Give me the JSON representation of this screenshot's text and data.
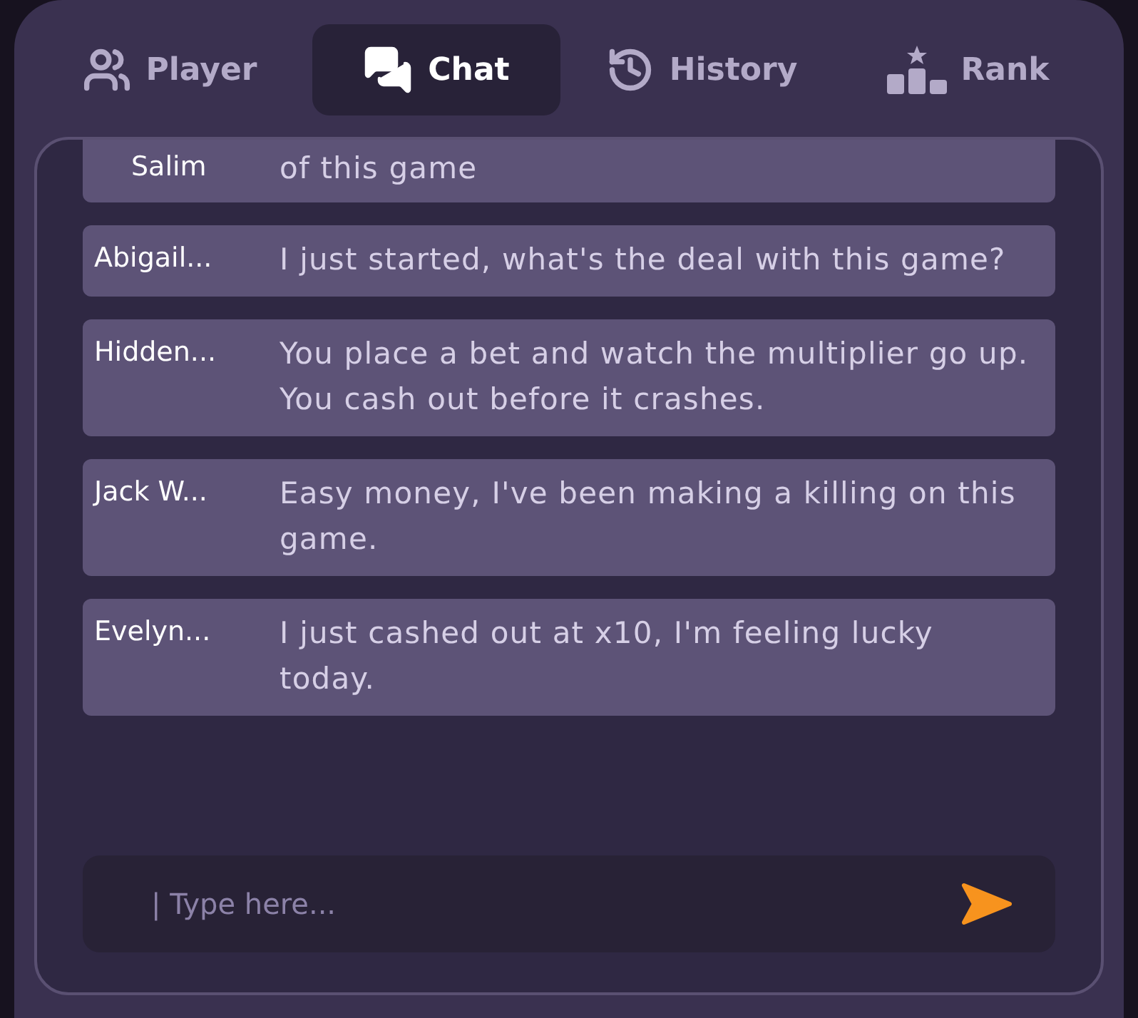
{
  "tabs": [
    {
      "label": "Player",
      "kind": "users",
      "selected": false
    },
    {
      "label": "Chat",
      "kind": "chat",
      "selected": true
    },
    {
      "label": "History",
      "kind": "history",
      "selected": false
    },
    {
      "label": "Rank",
      "kind": "rank",
      "selected": false
    }
  ],
  "messages": [
    {
      "name": "Salim",
      "text": "of this game"
    },
    {
      "name": "Abigail...",
      "text": "I just started, what's the deal with this game?"
    },
    {
      "name": "Hidden...",
      "text": "You place a bet and watch the multiplier go up. You cash out before it crashes."
    },
    {
      "name": "Jack W...",
      "text": "Easy money, I've been making a killing on this game."
    },
    {
      "name": "Evelyn...",
      "text": "I just cashed out at x10, I'm feeling lucky today."
    }
  ],
  "input": {
    "placeholder": "| Type here..."
  }
}
